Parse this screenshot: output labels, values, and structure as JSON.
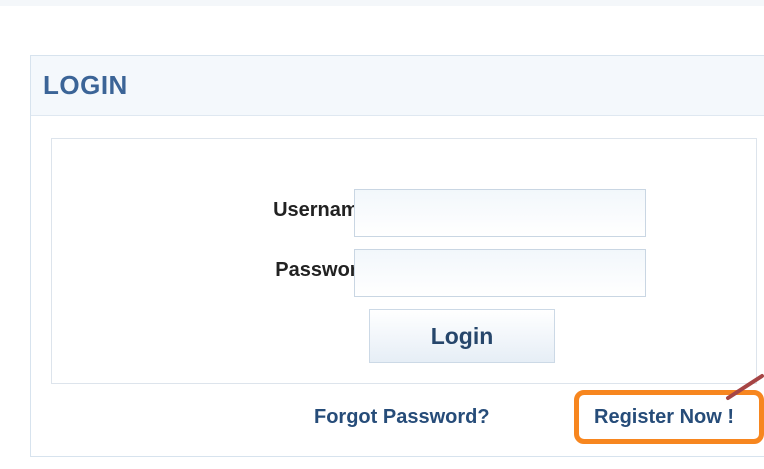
{
  "panel": {
    "title": "LOGIN"
  },
  "form": {
    "username_label": "Username :",
    "password_label": "Password :",
    "username_value": "",
    "password_value": "",
    "login_button": "Login"
  },
  "links": {
    "forgot_password": "Forgot Password?",
    "register_now": "Register Now !"
  },
  "colors": {
    "title": "#3b6497",
    "link": "#264c79",
    "highlight": "#f7861f",
    "arrow": "#a64545"
  }
}
